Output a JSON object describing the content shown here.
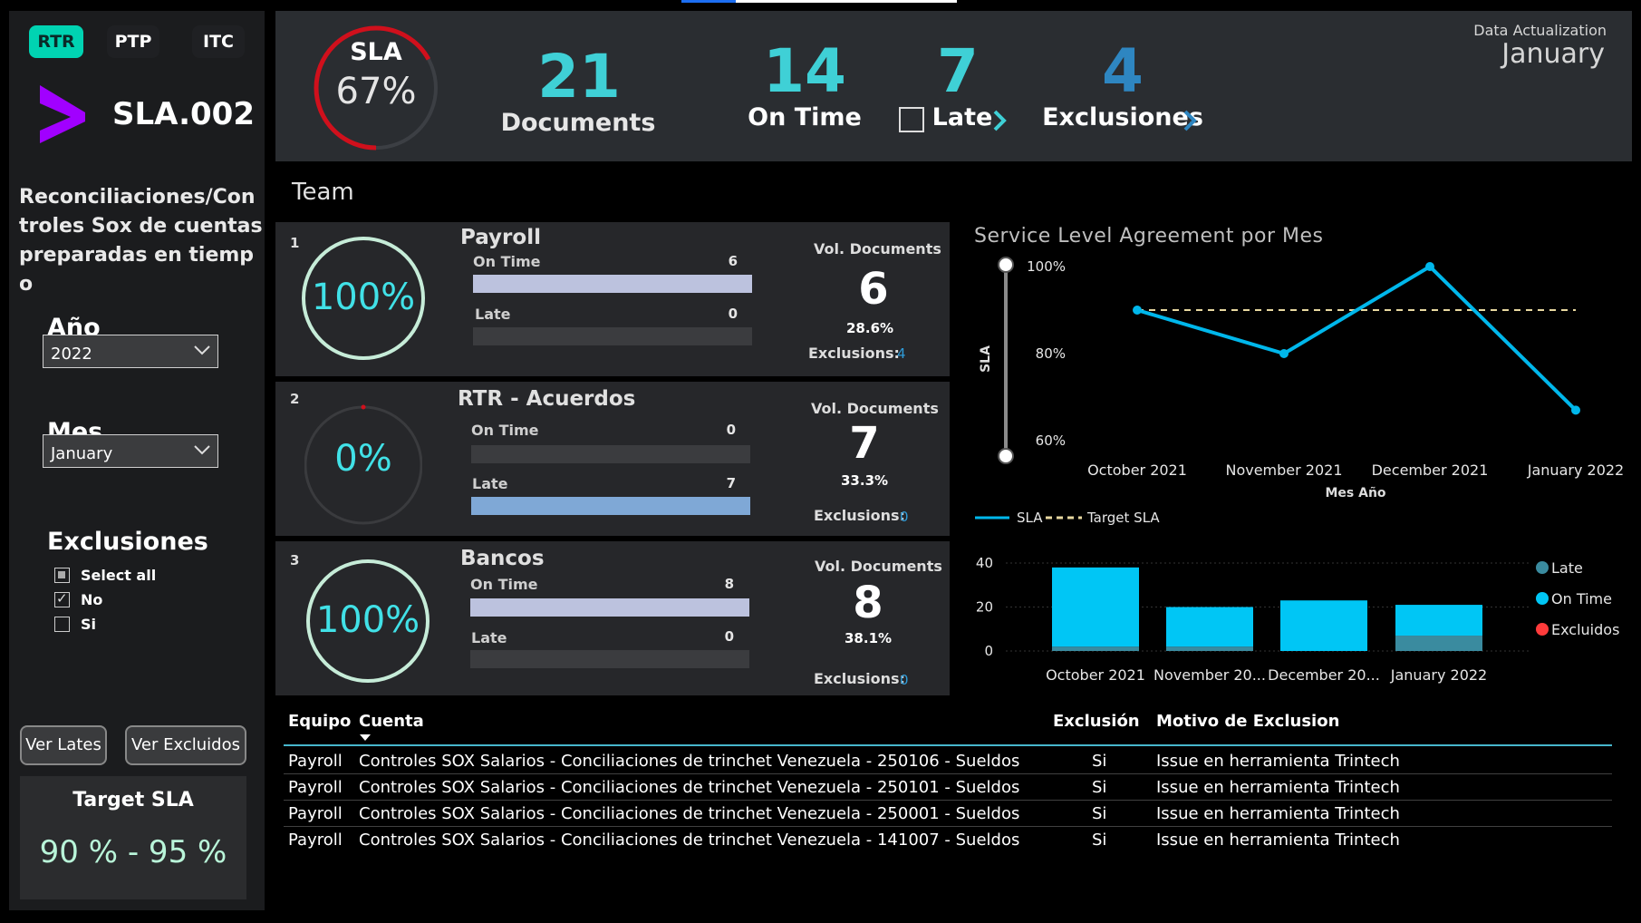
{
  "sidebar": {
    "modes": [
      {
        "label": "RTR",
        "active": true
      },
      {
        "label": "PTP",
        "active": false
      },
      {
        "label": "ITC",
        "active": false
      }
    ],
    "sla_code": "SLA.002",
    "description": "Reconciliaciones/Controles Sox de cuentas preparadas en tiempo",
    "year": {
      "title": "Año",
      "value": "2022"
    },
    "month": {
      "title": "Mes",
      "value": "January"
    },
    "exclusions": {
      "title": "Exclusiones",
      "options": [
        {
          "label": "Select all",
          "state": "partial"
        },
        {
          "label": "No",
          "state": "checked"
        },
        {
          "label": "Si",
          "state": "unchecked"
        }
      ]
    },
    "btn_lates": "Ver Lates",
    "btn_excluidos": "Ver Excluidos",
    "target_title": "Target SLA",
    "target_value": "90 % - 95 %",
    "accent_color": "#00d3b2",
    "logo_color": "#a100ff"
  },
  "kpi": {
    "sla_label": "SLA",
    "sla_value": "67%",
    "sla_fraction": 0.67,
    "documents": {
      "value": "21",
      "label": "Documents",
      "color": "#3fd0d6"
    },
    "on_time": {
      "value": "14",
      "label": "On Time",
      "color": "#3fd0d6"
    },
    "late": {
      "value": "7",
      "label": "Late",
      "color": "#3fd0d6"
    },
    "exclusiones": {
      "value": "4",
      "label": "Exclusiones",
      "color": "#2e86c1"
    },
    "data_actualization_label": "Data Actualization",
    "data_actualization_value": "January"
  },
  "team_title": "Team",
  "teams": [
    {
      "index": "1",
      "name": "Payroll",
      "pct": "100%",
      "ring_fraction": 1.0,
      "on_time_label": "On Time",
      "on_time": "6",
      "on_time_fraction": 1.0,
      "late_label": "Late",
      "late": "0",
      "late_fraction": 0.0,
      "vol_label": "Vol. Documents",
      "vol": "6",
      "vol_pct": "28.6%",
      "excl_label": "Exclusions:",
      "excl": "4"
    },
    {
      "index": "2",
      "name": "RTR - Acuerdos",
      "pct": "0%",
      "ring_fraction": 0.0,
      "on_time_label": "On Time",
      "on_time": "0",
      "on_time_fraction": 0.0,
      "late_label": "Late",
      "late": "7",
      "late_fraction": 1.0,
      "vol_label": "Vol. Documents",
      "vol": "7",
      "vol_pct": "33.3%",
      "excl_label": "Exclusions:",
      "excl": "0"
    },
    {
      "index": "3",
      "name": "Bancos",
      "pct": "100%",
      "ring_fraction": 1.0,
      "on_time_label": "On Time",
      "on_time": "8",
      "on_time_fraction": 1.0,
      "late_label": "Late",
      "late": "0",
      "late_fraction": 0.0,
      "vol_label": "Vol. Documents",
      "vol": "8",
      "vol_pct": "38.1%",
      "excl_label": "Exclusions:",
      "excl": "0"
    }
  ],
  "chart_data": [
    {
      "type": "line",
      "title": "Service Level Agreement por Mes",
      "xlabel": "Mes Año",
      "ylabel": "SLA",
      "categories": [
        "October 2021",
        "November 2021",
        "December 2021",
        "January 2022"
      ],
      "series": [
        {
          "name": "SLA",
          "values": [
            90,
            80,
            100,
            67
          ],
          "color": "#00b7eb"
        },
        {
          "name": "Target SLA",
          "values": [
            90,
            90,
            90,
            90
          ],
          "color": "#e8d8a0"
        }
      ],
      "ylim": [
        55,
        100
      ],
      "yticks": [
        "100%",
        "80%",
        "60%"
      ],
      "ytick_values": [
        100,
        80,
        60
      ]
    },
    {
      "type": "bar",
      "stacked": true,
      "categories": [
        "October 2021",
        "November 20...",
        "December 20...",
        "January 2022"
      ],
      "series": [
        {
          "name": "Late",
          "values": [
            2,
            2,
            0,
            7
          ],
          "color": "#3a8b9f"
        },
        {
          "name": "On Time",
          "values": [
            36,
            18,
            23,
            14
          ],
          "color": "#00c6f5"
        },
        {
          "name": "Excluidos",
          "values": [
            0,
            0,
            0,
            0
          ],
          "color": "#ff3b3b"
        }
      ],
      "ylim": [
        0,
        40
      ],
      "yticks": [
        "40",
        "20",
        "0"
      ],
      "ytick_values": [
        40,
        20,
        0
      ],
      "legend_position": "right"
    }
  ],
  "table": {
    "headers": {
      "equipo": "Equipo",
      "cuenta": "Cuenta",
      "exclusion": "Exclusión",
      "motivo": "Motivo de Exclusion"
    },
    "rows": [
      {
        "equipo": "Payroll",
        "cuenta": "Controles SOX Salarios - Conciliaciones de trinchet Venezuela - 250106 - Sueldos",
        "exclusion": "Si",
        "motivo": "Issue en herramienta Trintech"
      },
      {
        "equipo": "Payroll",
        "cuenta": "Controles SOX Salarios - Conciliaciones de trinchet Venezuela - 250101 - Sueldos",
        "exclusion": "Si",
        "motivo": "Issue en herramienta Trintech"
      },
      {
        "equipo": "Payroll",
        "cuenta": "Controles SOX Salarios - Conciliaciones de trinchet Venezuela - 250001 - Sueldos",
        "exclusion": "Si",
        "motivo": "Issue en herramienta Trintech"
      },
      {
        "equipo": "Payroll",
        "cuenta": "Controles SOX Salarios - Conciliaciones de trinchet Venezuela - 141007 - Sueldos",
        "exclusion": "Si",
        "motivo": "Issue en herramienta Trintech"
      }
    ]
  }
}
